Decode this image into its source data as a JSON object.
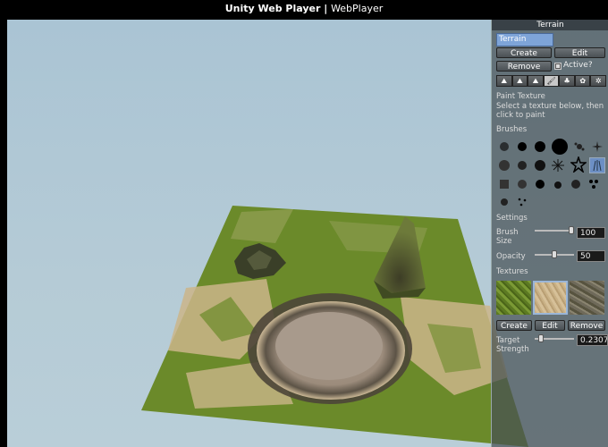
{
  "window": {
    "title": "Unity Web Player",
    "subtitle": "WebPlayer"
  },
  "panel": {
    "title": "Terrain",
    "name_value": "Terrain",
    "create_label": "Create",
    "edit_label": "Edit",
    "remove_label": "Remove",
    "active_label": "Active?",
    "active_checked": true,
    "tools": [
      {
        "icon": "raise-terrain-icon",
        "glyph": "⛰"
      },
      {
        "icon": "paint-height-icon",
        "glyph": "⛰"
      },
      {
        "icon": "smooth-height-icon",
        "glyph": "⛰"
      },
      {
        "icon": "paint-texture-icon",
        "glyph": "🖌"
      },
      {
        "icon": "place-trees-icon",
        "glyph": "♣"
      },
      {
        "icon": "paint-details-icon",
        "glyph": "✿"
      },
      {
        "icon": "settings-icon",
        "glyph": "✲"
      }
    ],
    "selected_tool": 3,
    "section_title": "Paint Texture",
    "help_line1": "Select a texture below, then",
    "help_line2": "click to paint",
    "brushes_label": "Brushes",
    "selected_brush": 11,
    "settings_label": "Settings",
    "brush_size_line1": "Brush",
    "brush_size_line2": "Size",
    "brush_size_value": "100",
    "opacity_label": "Opacity",
    "opacity_value": "50",
    "textures_label": "Textures",
    "textures": [
      "grass-texture",
      "sand-texture",
      "rock-texture"
    ],
    "selected_texture": 1,
    "tex_create_label": "Create",
    "tex_edit_label": "Edit",
    "tex_remove_label": "Remove",
    "target_strength_line1": "Target",
    "target_strength_line2": "Strength",
    "target_strength_value": "0.23076",
    "colors": {
      "accent": "#7ea4d8",
      "grass": "#6b8a2a",
      "sand": "#cbb58a",
      "rock": "#6f6a5a"
    }
  }
}
